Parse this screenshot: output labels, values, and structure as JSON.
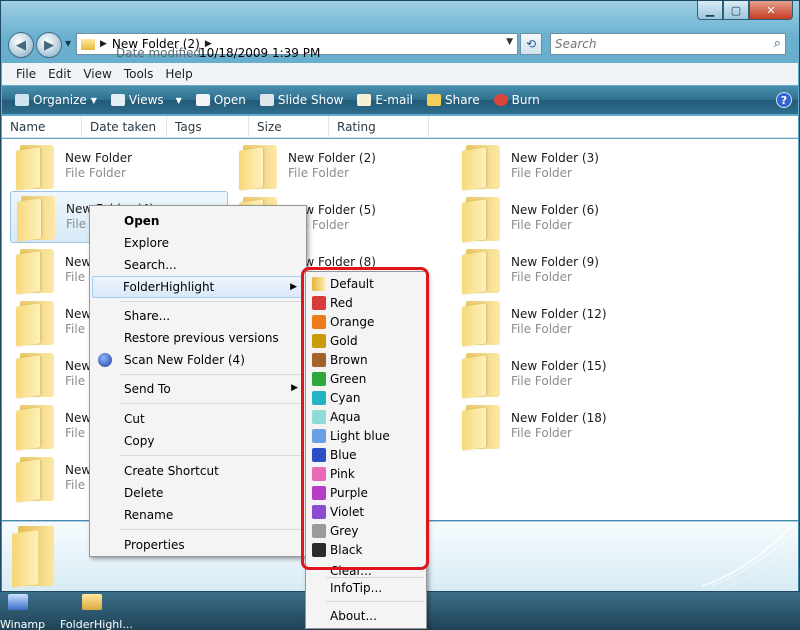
{
  "address": {
    "crumb": "New Folder (2)"
  },
  "search": {
    "placeholder": "Search"
  },
  "menubar": [
    "File",
    "Edit",
    "View",
    "Tools",
    "Help"
  ],
  "toolbar": [
    "Organize",
    "Views",
    "Open",
    "Slide Show",
    "E-mail",
    "Share",
    "Burn"
  ],
  "columns": [
    "Name",
    "Date taken",
    "Tags",
    "Size",
    "Rating"
  ],
  "files": [
    {
      "name": "New Folder",
      "type": "File Folder"
    },
    {
      "name": "New Folder (2)",
      "type": "File Folder"
    },
    {
      "name": "New Folder (3)",
      "type": "File Folder"
    },
    {
      "name": "New Folder (4)",
      "type": "File Folder"
    },
    {
      "name": "New Folder (5)",
      "type": "File Folder"
    },
    {
      "name": "New Folder (6)",
      "type": "File Folder"
    },
    {
      "name": "New Folder",
      "type": "File Folder"
    },
    {
      "name": "New Folder (8)",
      "type": "File Folder"
    },
    {
      "name": "New Folder (9)",
      "type": "File Folder"
    },
    {
      "name": "New Folder",
      "type": "File Folder"
    },
    {
      "name": "New Folder (12)",
      "type": "File Folder"
    },
    {
      "name": "New Folder",
      "type": "File Folder"
    },
    {
      "name": "New Folder (15)",
      "type": "File Folder"
    },
    {
      "name": "New Folder",
      "type": "File Folder"
    },
    {
      "name": "New Folder (18)",
      "type": "File Folder"
    },
    {
      "name": "New Folder",
      "type": "File Folder"
    }
  ],
  "details": {
    "label": "Date modified:",
    "value": "10/18/2009 1:39 PM"
  },
  "desktop": {
    "icon1": "Winamp",
    "icon2": "FolderHighl..."
  },
  "context_menu": {
    "open": "Open",
    "explore": "Explore",
    "search": "Search...",
    "folderhighlight": "FolderHighlight",
    "share": "Share...",
    "restore": "Restore previous versions",
    "scan": "Scan New Folder (4)",
    "sendto": "Send To",
    "cut": "Cut",
    "copy": "Copy",
    "shortcut": "Create Shortcut",
    "delete": "Delete",
    "rename": "Rename",
    "properties": "Properties"
  },
  "submenu": {
    "colors": [
      {
        "label": "Default",
        "color": "#f2c94c"
      },
      {
        "label": "Red",
        "color": "#d93a3a"
      },
      {
        "label": "Orange",
        "color": "#ee7a1c"
      },
      {
        "label": "Gold",
        "color": "#c99a0a"
      },
      {
        "label": "Brown",
        "color": "#a2622a"
      },
      {
        "label": "Green",
        "color": "#2fa63a"
      },
      {
        "label": "Cyan",
        "color": "#22b4c2"
      },
      {
        "label": "Aqua",
        "color": "#8fd9d6"
      },
      {
        "label": "Light blue",
        "color": "#6b9fe2"
      },
      {
        "label": "Blue",
        "color": "#2a4fc6"
      },
      {
        "label": "Pink",
        "color": "#e86ab5"
      },
      {
        "label": "Purple",
        "color": "#b73cc7"
      },
      {
        "label": "Violet",
        "color": "#8a4ad1"
      },
      {
        "label": "Grey",
        "color": "#9a9a9a"
      },
      {
        "label": "Black",
        "color": "#2a2a2a"
      }
    ],
    "clear": "Clear...",
    "infotip": "InfoTip...",
    "about": "About..."
  }
}
